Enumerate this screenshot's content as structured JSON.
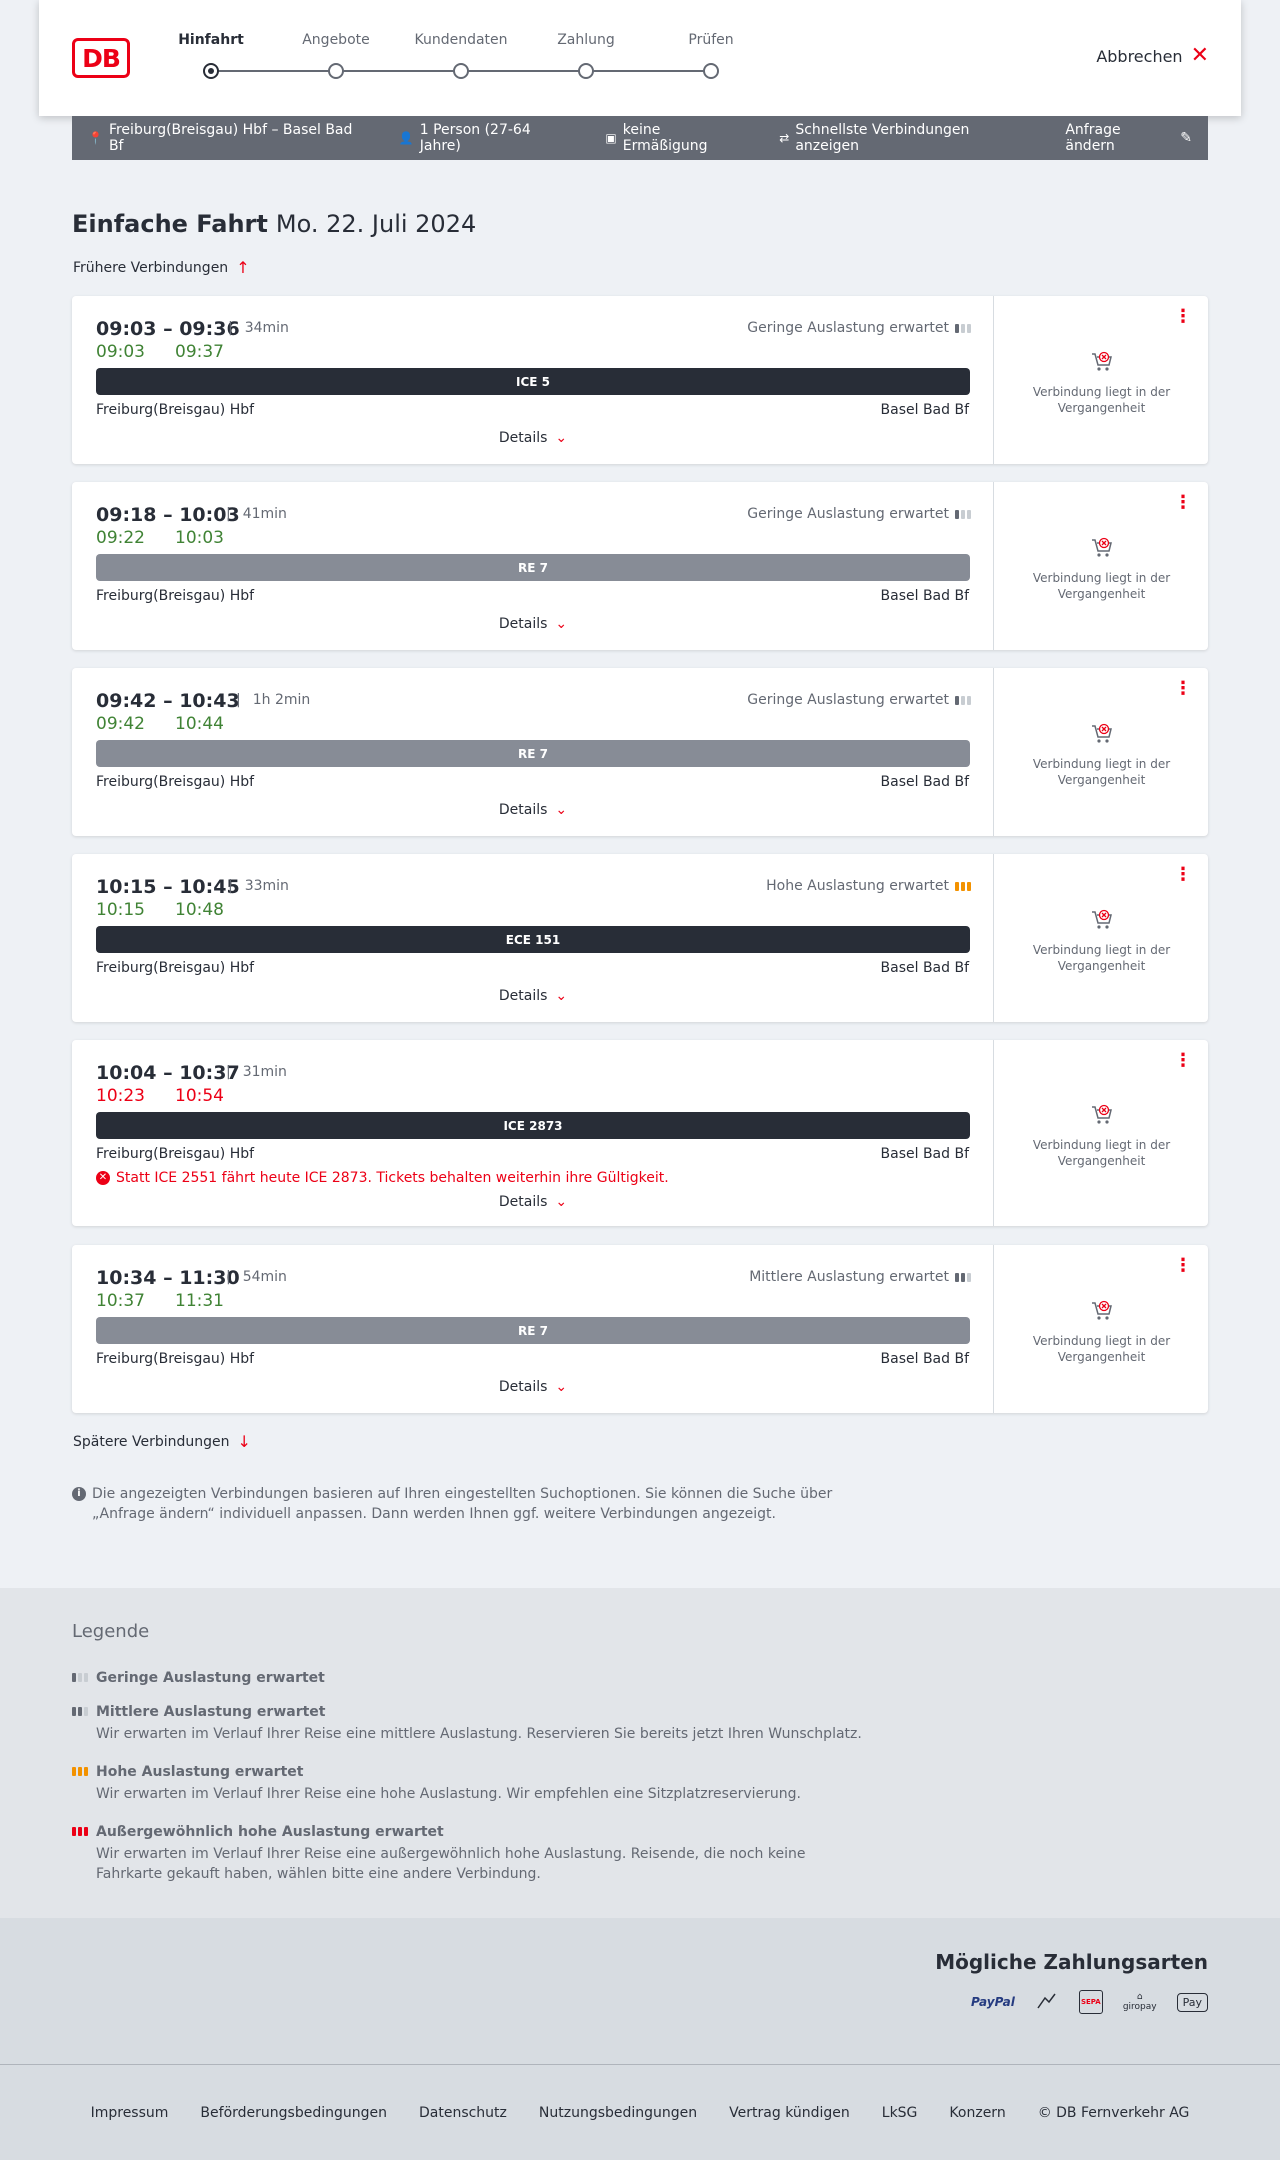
{
  "header": {
    "logo": "DB",
    "steps": [
      "Hinfahrt",
      "Angebote",
      "Kundendaten",
      "Zahlung",
      "Prüfen"
    ],
    "cancel": "Abbrechen"
  },
  "search": {
    "route": "Freiburg(Breisgau) Hbf – Basel Bad Bf",
    "persons": "1 Person (27-64 Jahre)",
    "discount": "keine Ermäßigung",
    "fastest": "Schnellste Verbindungen anzeigen",
    "change": "Anfrage ändern"
  },
  "page": {
    "title_bold": "Einfache Fahrt",
    "title_date": "Mo. 22. Juli 2024",
    "earlier": "Frühere Verbindungen",
    "later": "Spätere Verbindungen",
    "details": "Details",
    "past": "Verbindung liegt in der Vergangenheit",
    "info": "Die angezeigten Verbindungen basieren auf Ihren eingestellten Suchoptionen. Sie können die Suche über „Anfrage ändern“ individuell anpassen. Dann werden Ihnen ggf. weitere Verbindungen angezeigt."
  },
  "connections": [
    {
      "time": "09:03 – 09:36",
      "duration": "34min",
      "rt_dep": "09:03",
      "rt_arr": "09:37",
      "delayed": false,
      "load": "Geringe Auslastung erwartet",
      "load_level": 1,
      "train": "ICE 5",
      "train_style": "dark",
      "from": "Freiburg(Breisgau) Hbf",
      "to": "Basel Bad Bf",
      "message": ""
    },
    {
      "time": "09:18 – 10:03",
      "duration": "41min",
      "rt_dep": "09:22",
      "rt_arr": "10:03",
      "delayed": false,
      "load": "Geringe Auslastung erwartet",
      "load_level": 1,
      "train": "RE 7",
      "train_style": "grey",
      "from": "Freiburg(Breisgau) Hbf",
      "to": "Basel Bad Bf",
      "message": ""
    },
    {
      "time": "09:42 – 10:43",
      "duration": "1h 2min",
      "rt_dep": "09:42",
      "rt_arr": "10:44",
      "delayed": false,
      "load": "Geringe Auslastung erwartet",
      "load_level": 1,
      "train": "RE 7",
      "train_style": "grey",
      "from": "Freiburg(Breisgau) Hbf",
      "to": "Basel Bad Bf",
      "message": ""
    },
    {
      "time": "10:15 – 10:45",
      "duration": "33min",
      "rt_dep": "10:15",
      "rt_arr": "10:48",
      "delayed": false,
      "load": "Hohe Auslastung erwartet",
      "load_level": 3,
      "train": "ECE 151",
      "train_style": "dark",
      "from": "Freiburg(Breisgau) Hbf",
      "to": "Basel Bad Bf",
      "message": ""
    },
    {
      "time": "10:04 – 10:37",
      "duration": "31min",
      "rt_dep": "10:23",
      "rt_arr": "10:54",
      "delayed": true,
      "load": "",
      "load_level": 0,
      "train": "ICE 2873",
      "train_style": "dark",
      "from": "Freiburg(Breisgau) Hbf",
      "to": "Basel Bad Bf",
      "message": "Statt ICE 2551 fährt heute ICE 2873. Tickets behalten weiterhin ihre Gültigkeit."
    },
    {
      "time": "10:34 – 11:30",
      "duration": "54min",
      "rt_dep": "10:37",
      "rt_arr": "11:31",
      "delayed": false,
      "load": "Mittlere Auslastung erwartet",
      "load_level": 2,
      "train": "RE 7",
      "train_style": "grey",
      "from": "Freiburg(Breisgau) Hbf",
      "to": "Basel Bad Bf",
      "message": ""
    }
  ],
  "legend": {
    "title": "Legende",
    "items": [
      {
        "title": "Geringe Auslastung erwartet",
        "desc": "",
        "level": 1
      },
      {
        "title": "Mittlere Auslastung erwartet",
        "desc": "Wir erwarten im Verlauf Ihrer Reise eine mittlere Auslastung. Reservieren Sie bereits jetzt Ihren Wunschplatz.",
        "level": 2
      },
      {
        "title": "Hohe Auslastung erwartet",
        "desc": "Wir erwarten im Verlauf Ihrer Reise eine hohe Auslastung. Wir empfehlen eine Sitzplatzreservierung.",
        "level": 3
      },
      {
        "title": "Außergewöhnlich hohe Auslastung erwartet",
        "desc": "Wir erwarten im Verlauf Ihrer Reise eine außergewöhnlich hohe Auslastung. Reisende, die noch keine Fahrkarte gekauft haben, wählen bitte eine andere Verbindung.",
        "level": 4
      }
    ]
  },
  "payment": {
    "title": "Mögliche Zahlungsarten",
    "methods": [
      "PayPal",
      "SEPA",
      "giropay",
      "Pay"
    ]
  },
  "footer": [
    "Impressum",
    "Beförderungsbedingungen",
    "Datenschutz",
    "Nutzungsbedingungen",
    "Vertrag kündigen",
    "LkSG",
    "Konzern",
    "© DB Fernverkehr AG"
  ],
  "colors": {
    "red": "#ec0016",
    "green": "#408335",
    "dark": "#282d37",
    "grey": "#878c96",
    "orange": "#f39200"
  }
}
